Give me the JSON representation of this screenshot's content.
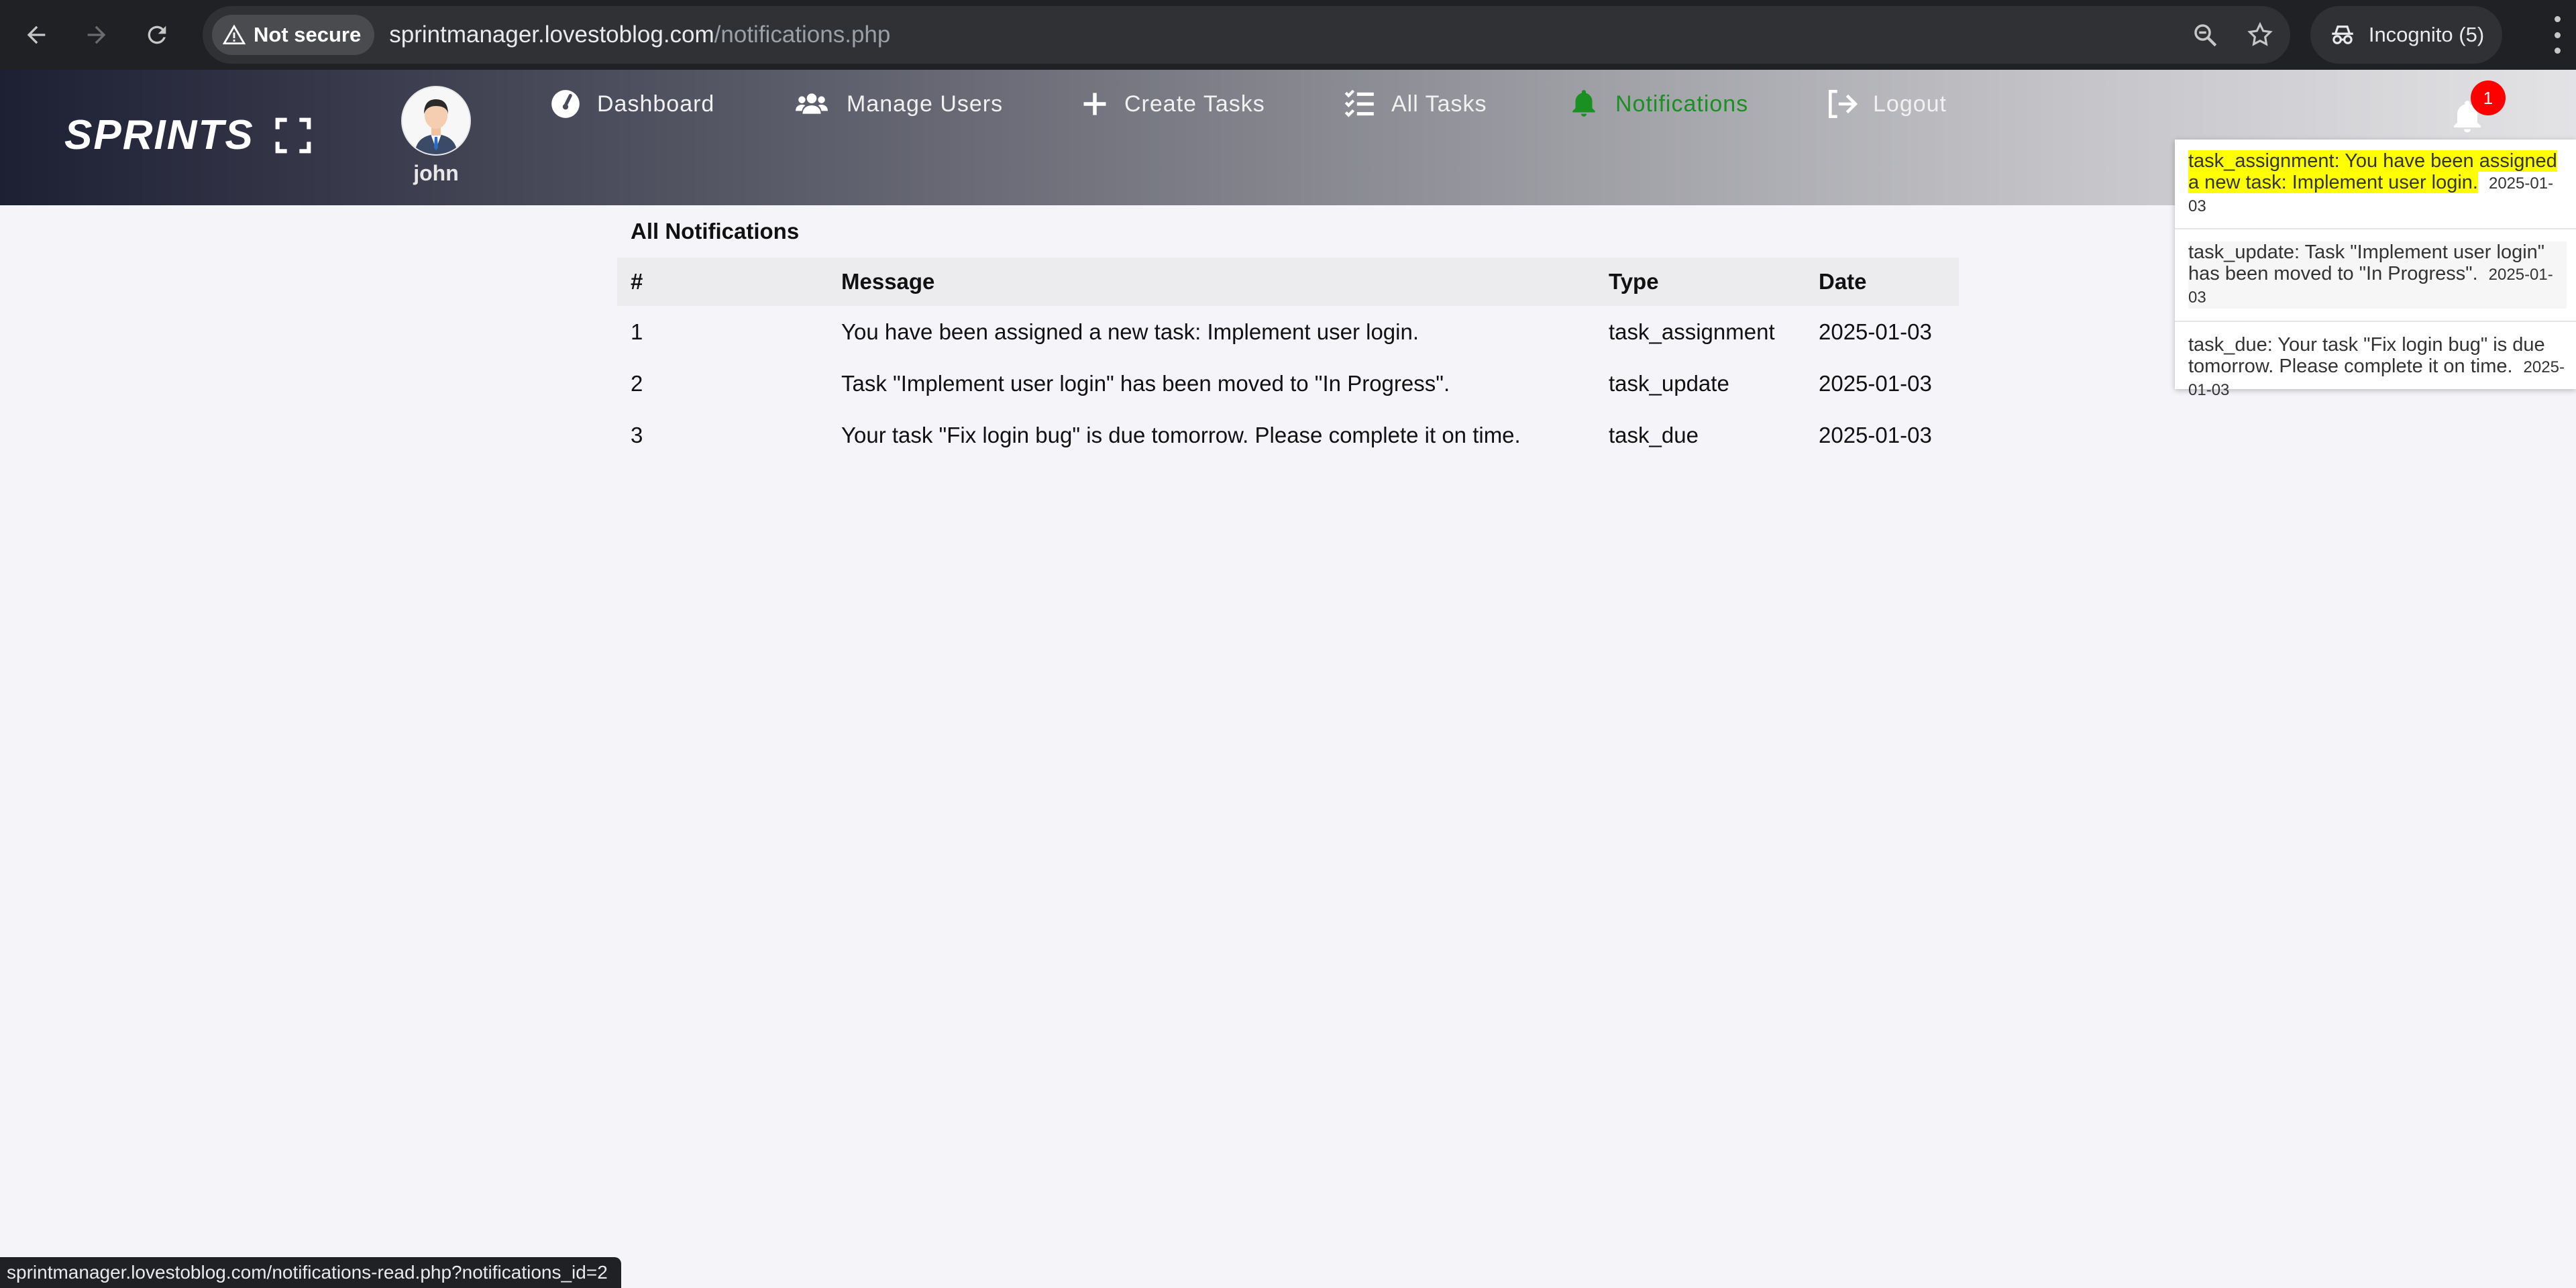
{
  "browser": {
    "security_label": "Not secure",
    "url_host": "sprintmanager.lovestoblog.com",
    "url_path": "/notifications.php",
    "incognito_label": "Incognito (5)",
    "status_url": "sprintmanager.lovestoblog.com/notifications-read.php?notifications_id=2"
  },
  "header": {
    "logo": "SPRINTS",
    "username": "john",
    "menu": [
      {
        "label": "Dashboard",
        "icon": "speedometer-icon"
      },
      {
        "label": "Manage Users",
        "icon": "users-icon"
      },
      {
        "label": "Create Tasks",
        "icon": "plus-icon"
      },
      {
        "label": "All Tasks",
        "icon": "checklist-icon"
      },
      {
        "label": "Notifications",
        "icon": "bell-icon",
        "active": true
      },
      {
        "label": "Logout",
        "icon": "logout-icon"
      }
    ],
    "notification_count": "1",
    "active_color": "#1a8f22"
  },
  "main": {
    "title": "All Notifications",
    "columns": [
      "#",
      "Message",
      "Type",
      "Date"
    ],
    "rows": [
      {
        "num": "1",
        "message": "You have been assigned a new task: Implement user login.",
        "type": "task_assignment",
        "date": "2025-01-03"
      },
      {
        "num": "2",
        "message": "Task \"Implement user login\" has been moved to \"In Progress\".",
        "type": "task_update",
        "date": "2025-01-03"
      },
      {
        "num": "3",
        "message": "Your task \"Fix login bug\" is due tomorrow. Please complete it on time.",
        "type": "task_due",
        "date": "2025-01-03"
      }
    ]
  },
  "dropdown": {
    "items": [
      {
        "text": "task_assignment: You have been assigned a new task: Implement user login.",
        "date": "2025-01-03"
      },
      {
        "text": "task_update: Task \"Implement user login\" has been moved to \"In Progress\".",
        "date": "2025-01-03"
      },
      {
        "text": "task_due: Your task \"Fix login bug\" is due tomorrow. Please complete it on time.",
        "date": "2025-01-03"
      }
    ],
    "highlight_color": "#ffff00"
  }
}
